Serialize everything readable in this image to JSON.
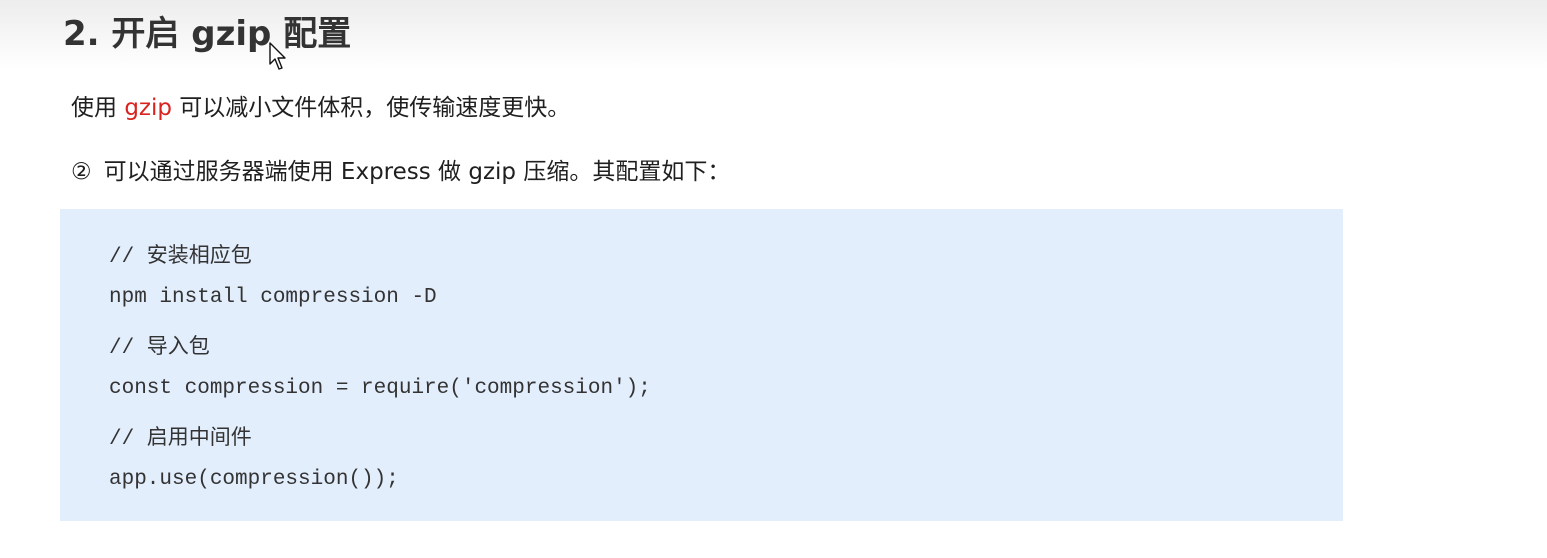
{
  "section": {
    "heading": "2. 开启 gzip 配置"
  },
  "intro": {
    "prefix": "使用 ",
    "highlight": "gzip",
    "suffix": " 可以减小文件体积，使传输速度更快。",
    "highlight_color": "#d9231f"
  },
  "step": {
    "number": "②",
    "text": "可以通过服务器端使用 Express 做 gzip 压缩。其配置如下："
  },
  "code": {
    "background": "#e3eefd",
    "lines": [
      "// 安装相应包",
      "npm install compression -D",
      "// 导入包",
      "const compression = require('compression');",
      "// 启用中间件",
      "app.use(compression());"
    ]
  },
  "cursor": {
    "icon": "mouse-pointer-icon"
  }
}
